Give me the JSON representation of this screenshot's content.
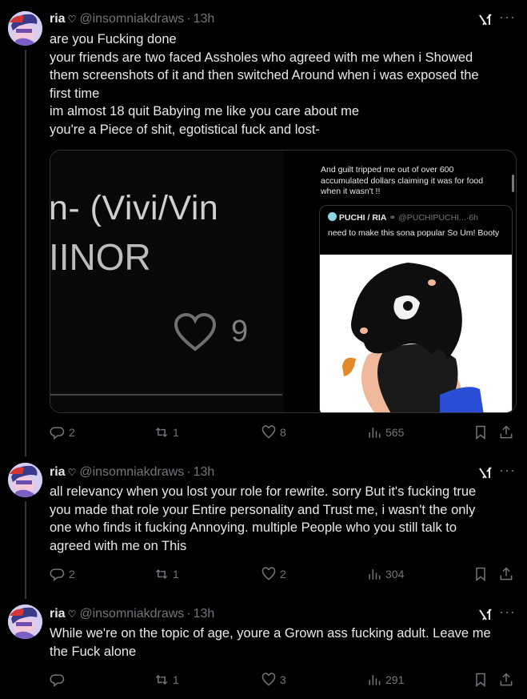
{
  "tweets": [
    {
      "name": "ria",
      "handle": "@insomniakdraws",
      "time": "13h",
      "lines": [
        "are you Fucking done",
        "your friends are two faced Assholes who agreed with me when i Showed",
        "them screenshots of it and then switched Around when i was exposed the",
        "first time",
        "im almost 18 quit Babying me like you care about me",
        "you're a Piece of shit, egotistical fuck and lost-"
      ],
      "replies": "2",
      "reposts": "1",
      "likes": "8",
      "views": "565"
    },
    {
      "name": "ria",
      "handle": "@insomniakdraws",
      "time": "13h",
      "lines": [
        "all relevancy when you lost your role for rewrite. sorry But it's fucking true",
        "you made that role your Entire personality and Trust me, i wasn't the only",
        "one who finds it fucking Annoying. multiple People who you still talk to",
        "agreed with me on This"
      ],
      "replies": "2",
      "reposts": "1",
      "likes": "2",
      "views": "304"
    },
    {
      "name": "ria",
      "handle": "@insomniakdraws",
      "time": "13h",
      "lines": [
        "While we're on the topic of age, youre a Grown ass fucking adult. Leave me",
        "the Fuck alone"
      ],
      "replies": "",
      "reposts": "1",
      "likes": "3",
      "views": "291"
    }
  ],
  "separator": "·",
  "media": {
    "left": {
      "title": "n- (Vivi/Vin",
      "subtitle": "IINOR",
      "likes": "9"
    },
    "right": {
      "text": "And guilt tripped me out of over 600 accumulated dollars claiming it was for food when it wasn't !!",
      "quote_name": "PUCHI / RIA",
      "quote_handle": "@PUCHIPUCHI...",
      "quote_time": "6h",
      "quote_text": "need to make this sona popular So Um! Booty"
    }
  },
  "more_glyph": "···",
  "colors": {
    "background": "#000000",
    "text": "#e7e9ea",
    "muted": "#71767b",
    "border": "#2f3336"
  }
}
